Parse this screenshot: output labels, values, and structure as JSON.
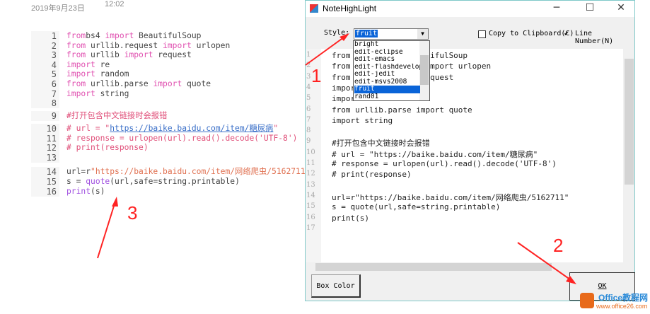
{
  "note": {
    "date": "2019年9月23日",
    "time": "12:02"
  },
  "bg_code": {
    "lines": [
      {
        "n": "1",
        "s": [
          [
            "kw",
            "from"
          ],
          [
            "",
            "bs4 "
          ],
          [
            "kw",
            "import"
          ],
          [
            "",
            " BeautifulSoup"
          ]
        ]
      },
      {
        "n": "2",
        "s": [
          [
            "kw",
            "from"
          ],
          [
            "",
            " urllib.request "
          ],
          [
            "kw",
            "import"
          ],
          [
            "",
            " urlopen"
          ]
        ]
      },
      {
        "n": "3",
        "s": [
          [
            "kw",
            "from"
          ],
          [
            "",
            " urllib "
          ],
          [
            "kw",
            "import"
          ],
          [
            "",
            " request"
          ]
        ]
      },
      {
        "n": "4",
        "s": [
          [
            "kw",
            "import"
          ],
          [
            "",
            " re"
          ]
        ]
      },
      {
        "n": "5",
        "s": [
          [
            "kw",
            "import"
          ],
          [
            "",
            " random"
          ]
        ]
      },
      {
        "n": "6",
        "s": [
          [
            "kw",
            "from"
          ],
          [
            "",
            " urllib.parse "
          ],
          [
            "kw",
            "import"
          ],
          [
            "",
            " quote"
          ]
        ]
      },
      {
        "n": "7",
        "s": [
          [
            "kw",
            "import"
          ],
          [
            "",
            " string"
          ]
        ]
      },
      {
        "n": "8",
        "s": []
      },
      {
        "n": "9",
        "s": [
          [
            "cm",
            "#打开包含中文链接时会报错"
          ]
        ]
      },
      {
        "n": "10",
        "s": [
          [
            "cm",
            "# url = \""
          ],
          [
            "lk",
            "https://baike.baidu.com/item/糖尿病"
          ],
          [
            "cm",
            "\""
          ]
        ]
      },
      {
        "n": "11",
        "s": [
          [
            "cm",
            "# response = urlopen(url).read().decode('UTF-8')"
          ]
        ]
      },
      {
        "n": "12",
        "s": [
          [
            "cm",
            "# print(response)"
          ]
        ]
      },
      {
        "n": "13",
        "s": []
      },
      {
        "n": "14",
        "s": [
          [
            "",
            "url=r"
          ],
          [
            "st",
            "\"https://baike.baidu.com/item/网络爬虫/5162711\""
          ]
        ]
      },
      {
        "n": "15",
        "s": [
          [
            "",
            "s = "
          ],
          [
            "fn",
            "quote"
          ],
          [
            "",
            "(url,safe=string.printable)"
          ]
        ]
      },
      {
        "n": "16",
        "s": [
          [
            "fn",
            "print"
          ],
          [
            "",
            "(s)"
          ]
        ]
      }
    ]
  },
  "dialog": {
    "title": "NoteHighLight",
    "style_label": "Style:",
    "style_value": "fruit",
    "style_options": [
      "bright",
      "edit-eclipse",
      "edit-emacs",
      "edit-flashdevelop",
      "edit-jedit",
      "edit-msvs2008",
      "fruit",
      "rand01"
    ],
    "copy_label": "Copy to Clipboard(C)",
    "copy_checked": false,
    "line_number_label": "Line Number(N)",
    "line_number_checked": true,
    "code": [
      "from bs4 import BeautifulSoup",
      "from urllib.request import urlopen",
      "from urllib import request",
      "import re",
      "import random",
      "from urllib.parse import quote",
      "import string",
      "",
      "#打开包含中文链接时会报错",
      "# url = \"https://baike.baidu.com/item/糖尿病\"",
      "# response = urlopen(url).read().decode('UTF-8')",
      "# print(response)",
      "",
      "url=r\"https://baike.baidu.com/item/网络爬虫/5162711\"",
      "s = quote(url,safe=string.printable)",
      "print(s)",
      ""
    ],
    "box_color_label": "Box Color",
    "ok_label": "OK"
  },
  "annotations": {
    "a1": "1",
    "a2": "2",
    "a3": "3"
  },
  "watermark": {
    "brand": "Office教程网",
    "url": "www.office26.com"
  }
}
